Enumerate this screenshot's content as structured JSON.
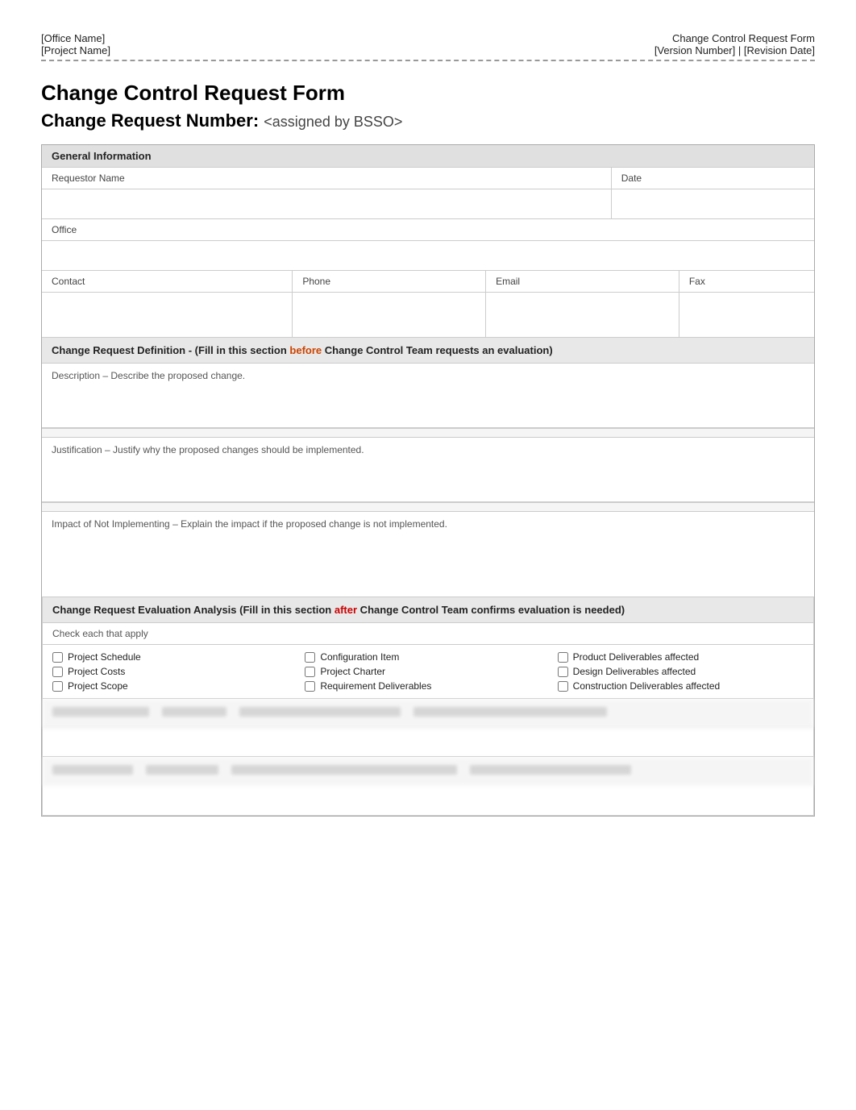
{
  "header": {
    "office_name": "[Office Name]",
    "project_name": "[Project Name]",
    "form_title_right": "Change Control Request Form",
    "version_revision": "[Version Number] | [Revision Date]"
  },
  "form": {
    "title": "Change Control Request Form",
    "subtitle_label": "Change Request Number:",
    "subtitle_value": "<assigned by BSSO>",
    "general_info": {
      "section_label": "General Information",
      "fields": {
        "requestor_label": "Requestor  Name",
        "date_label": "Date",
        "office_label": "Office",
        "contact_label": "Contact",
        "phone_label": "Phone",
        "email_label": "Email",
        "fax_label": "Fax"
      }
    },
    "change_request_def": {
      "header_part1": "Change Request Definition - (Fill in this section ",
      "header_before": "before",
      "header_part2": " Change Control Team requests an evaluation)",
      "description_label": "Description – Describe the proposed change.",
      "justification_label": "Justification – Justify why the proposed changes should be implemented.",
      "impact_label": "Impact of Not Implementing – Explain the impact if the proposed change is not implemented."
    },
    "evaluation_analysis": {
      "header_part1": "Change Request Evaluation Analysis (Fill in this section ",
      "header_after": "after",
      "header_part2": " Change Control Team confirms evaluation is needed)",
      "check_each_label": "Check each that apply",
      "checkboxes": [
        {
          "label": "Project Schedule",
          "checked": false
        },
        {
          "label": "Configuration  Item",
          "checked": false
        },
        {
          "label": "Product Deliverables affected",
          "checked": false
        },
        {
          "label": "Project Costs",
          "checked": false
        },
        {
          "label": "Project Charter",
          "checked": false
        },
        {
          "label": "Design Deliverables affected",
          "checked": false
        },
        {
          "label": "Project Scope",
          "checked": false
        },
        {
          "label": "Requirement Deliverables",
          "checked": false
        },
        {
          "label": "Construction Deliverables affected",
          "checked": false
        }
      ]
    }
  }
}
